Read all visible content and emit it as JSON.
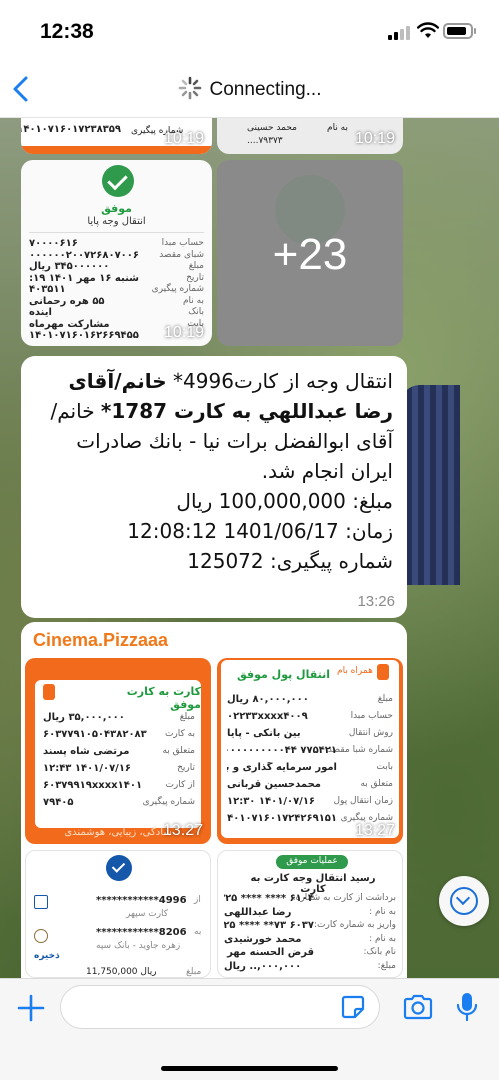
{
  "status_bar": {
    "time": "12:38"
  },
  "nav": {
    "title": "Connecting..."
  },
  "messages": {
    "top_left_image": {
      "time": "10:19",
      "row_text": "۱۴۰۱۰۷۱۶۰۱۷۲۳۸۳۵۹",
      "row_label": "شماره پیگیری"
    },
    "top_right_image": {
      "time": "10:19",
      "name": "محمد حسینی",
      "label": "به نام",
      "code": "۷۹۳۷۳...."
    },
    "receipt_image": {
      "time": "10:19",
      "status": "موفق",
      "title": "انتقال وجه پایا",
      "rows": [
        {
          "label": "حساب مبدا",
          "value": "۷۰۰۰۰۶۱۶"
        },
        {
          "label": "شبای مقصد",
          "value": "IR۵۶۰۶۲۰۰۰۰۰۰۲۰۰۷۲۶۸۰۷۰۰۶"
        },
        {
          "label": "مبلغ",
          "value": "۳۴۵۰۰۰۰۰۰ ریال"
        },
        {
          "label": "تاریخ",
          "value": "شنبه ۱۶ مهر ۱۴۰۱ ۰۹:۱۹"
        },
        {
          "label": "شماره پیگیری",
          "value": "۴۰۳۵۱۱"
        },
        {
          "label": "به نام",
          "value": "۵۵ هره رحمانی"
        },
        {
          "label": "بانک",
          "value": "آینده"
        },
        {
          "label": "بابت",
          "value": "مشارکت مهرماه"
        },
        {
          "label": "",
          "value": "۱۴۰۱۰۷۱۶۰۱۶۲۶۶۹۴۵۵"
        }
      ]
    },
    "more_images": {
      "label": "+23"
    },
    "text_message": {
      "line1_prefix": "انتقال وجه از کارت4996* ",
      "line1_bold": "خانم/آقای رضا عبداللهي به کارت 1787*",
      "line1_suffix": " خانم/آقای ابوالفضل برات نیا - بانك صادرات ایران انجام شد.",
      "amount": "مبلغ: 100,000,000 ریال",
      "datetime": "زمان: 1401/06/17   12:08:12",
      "tracking": "شماره پیگیری: 125072",
      "time": "13:26"
    },
    "group": {
      "sender": "Cinema.Pizzaaa",
      "card_left": {
        "time": "13:27",
        "brand": "همراه بام",
        "title": "کارت به کارت موفق",
        "rows": [
          {
            "label": "مبلغ",
            "value": "۳۵,۰۰۰,۰۰۰ ریال"
          },
          {
            "label": "به کارت",
            "value": "۶۰۳۷۷۹۱۰۵۰۴۳۸۲۰۸۳"
          },
          {
            "label": "متعلق به",
            "value": "مرتضی شاه پسند"
          },
          {
            "label": "تاریخ",
            "value": "۱۴۰۱/۰۷/۱۶  ۱۲:۴۳"
          },
          {
            "label": "از کارت",
            "value": "۶۰۳۷۹۹۱۹xxxx۱۴۰۱"
          },
          {
            "label": "شماره پیگیری",
            "value": "۷۹۴۰۵"
          }
        ],
        "footer": "سادگی، زیبایی، هوشمندی"
      },
      "card_right": {
        "time": "13:27",
        "brand": "همراه بام",
        "title": "انتقال پول موفق",
        "rows": [
          {
            "label": "مبلغ",
            "value": "۸۰,۰۰۰,۰۰۰ ریال"
          },
          {
            "label": "حساب مبدا",
            "value": "۰۲۲۳۳xxxx۴۰۰۹"
          },
          {
            "label": "روش انتقال",
            "value": "بین بانکی - پایا"
          },
          {
            "label": "شماره شبا مقصد",
            "value": "IR۴۳۰۱۶۰۰۰۰۰۰۰۰۰۰۴۴ ۷۷۵۴۲۱"
          },
          {
            "label": "بابت",
            "value": "امور سرمایه گذاری و بورس"
          },
          {
            "label": "متعلق به",
            "value": "محمدحسین قربانی"
          },
          {
            "label": "زمان انتقال پول",
            "value": "۱۴۰۱/۰۷/۱۶  ۱۲:۳۰"
          },
          {
            "label": "شماره پیگیری",
            "value": "۱۴۰۱۰۷۱۶۰۱۷۲۴۲۶۹۱۵۱"
          }
        ]
      },
      "card_bl": {
        "card1": "************4996",
        "card1_name": "کارت سپهر",
        "card2": "************8206",
        "card2_name": "زهره جاوید - بانک سپه",
        "save": "ذخیره",
        "amount_label": "مبلغ",
        "amount": "11,750,000 ریال",
        "from": "از",
        "to": "به"
      },
      "card_br": {
        "status": "عملیات موفق",
        "title": "رسید انتقال وجه کارت به کارت",
        "rows": [
          {
            "label": "برداشت از کارت به شماره:",
            "value": "۶۱۰۴ **** **** ۱۳۲۵"
          },
          {
            "label": "به نام :",
            "value": "رضا عبداللهی"
          },
          {
            "label": "واریز به شماره کارت:",
            "value": "۶۰۳۷ ۷۳** **** ۴۸۲۵"
          },
          {
            "label": "به نام :",
            "value": "محمد خورشیدی"
          },
          {
            "label": "نام بانک:",
            "value": "قرض الحسنه مهر ایران"
          },
          {
            "label": "مبلغ:",
            "value": "۰۰۰,۰۰۰,.. ریال"
          }
        ]
      }
    }
  },
  "input": {
    "placeholder": ""
  }
}
